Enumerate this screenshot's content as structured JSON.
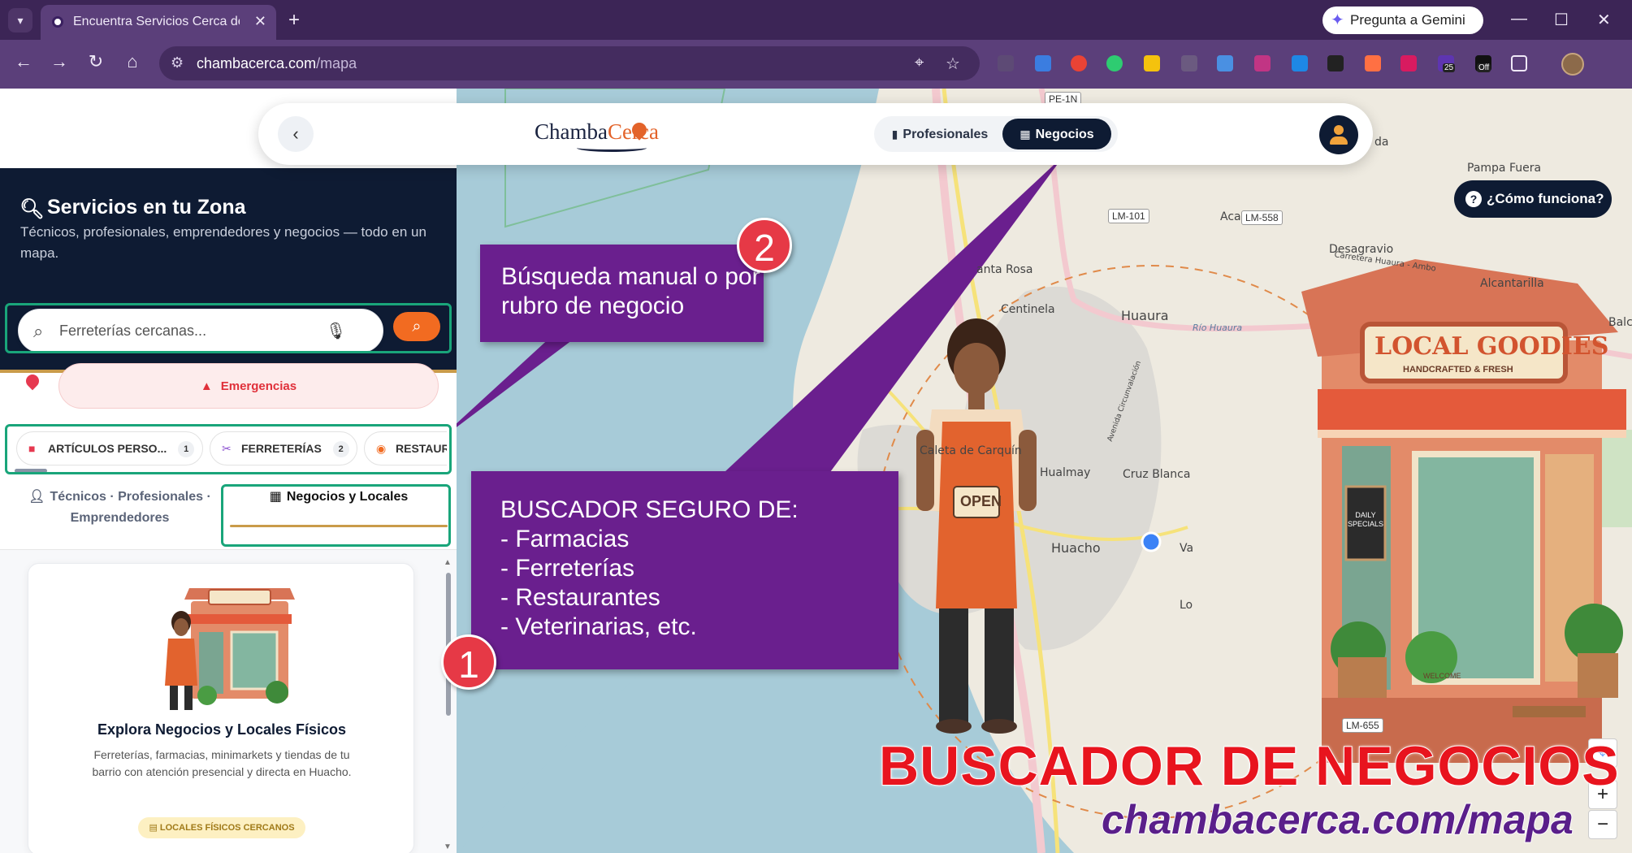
{
  "browser": {
    "tab_title": "Encuentra Servicios Cerca de Ti",
    "gemini_label": "Pregunta a Gemini",
    "url_host": "chambacerca.com",
    "url_path": "/mapa",
    "ext_badge_count": "25",
    "ext_badge_off": "Off"
  },
  "header": {
    "brand_main": "Chamba",
    "brand_accent": "Cerca",
    "seg_professionals": "Profesionales",
    "seg_businesses": "Negocios"
  },
  "panel": {
    "title": "Servicios en tu Zona",
    "description": "Técnicos, profesionales, emprendedores y negocios — todo en un mapa.",
    "search_placeholder": "Ferreterías cercanas...",
    "emergency_label": "Emergencias",
    "categories": [
      {
        "label": "ARTÍCULOS PERSO...",
        "count": "1",
        "color": "#e63950"
      },
      {
        "label": "FERRETERÍAS",
        "count": "2",
        "color": "#8a4fd0"
      },
      {
        "label": "RESTAURA",
        "count": "",
        "color": "#f26b21"
      }
    ],
    "tab_people": "Técnicos · Profesionales · Emprendedores",
    "tab_business": "Negocios y Locales",
    "card_title": "Explora Negocios y Locales Físicos",
    "card_desc": "Ferreterías, farmacias, minimarkets y tiendas de tu barrio con atención presencial y directa en Huacho.",
    "card_badge": "LOCALES FÍSICOS CERCANOS"
  },
  "map": {
    "how_label": "¿Cómo funciona?",
    "labels": [
      "Pampa Fuera",
      "Acaray",
      "Desagravio",
      "Alcantarilla",
      "anta Rosa",
      "Centinela",
      "Huaura",
      "Río Huaura",
      "Caleta de Carquín",
      "Hualmay",
      "Cruz Blanca",
      "Huacho",
      "Balc",
      "Carretera Huaura - Ambo",
      "Avenida Circunvalación",
      "da",
      "Va",
      "Lo"
    ],
    "road_badges": [
      "PE-1N",
      "LM-101",
      "LM-558",
      "LM-655"
    ],
    "zoom_in": "+",
    "zoom_out": "−"
  },
  "annotations": {
    "callout_search": "Búsqueda manual o por rubro de negocio",
    "callout_secure": "BUSCADOR SEGURO DE:\n- Farmacias\n- Ferreterías\n- Restaurantes\n- Veterinarias, etc.",
    "badge_one": "1",
    "badge_two": "2",
    "promo_title": "BUSCADOR DE NEGOCIOS",
    "promo_url": "chambacerca.com/mapa"
  },
  "illustration": {
    "shop_sign": "LOCAL GOODIES",
    "shop_sign_sub": "HANDCRAFTED & FRESH",
    "open_sign": "OPEN",
    "board_text": "DAILY SPECIALS",
    "welcome": "WELCOME"
  },
  "colors": {
    "navy": "#0e1b33",
    "accent_orange": "#f26b21",
    "callout_purple": "#6a1f8e",
    "highlight_green": "#19a57a",
    "promo_red": "#e8141e",
    "tab_underline_gold": "#c99b4a"
  }
}
